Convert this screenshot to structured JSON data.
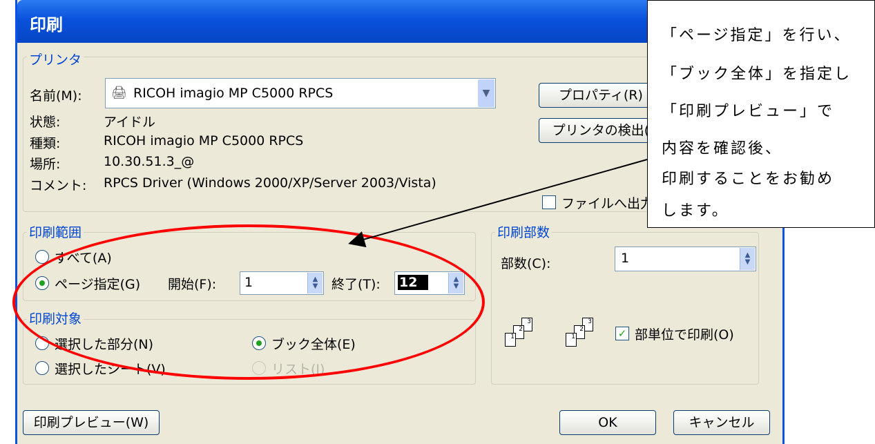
{
  "window": {
    "title": "印刷"
  },
  "printer": {
    "group_label": "プリンタ",
    "name_label": "名前(M):",
    "name_value": "RICOH imagio MP C5000 RPCS",
    "status_label": "状態:",
    "status_value": "アイドル",
    "type_label": "種類:",
    "type_value": "RICOH imagio MP C5000 RPCS",
    "location_label": "場所:",
    "location_value": "10.30.51.3_@",
    "comment_label": "コメント:",
    "comment_value": "RPCS Driver (Windows 2000/XP/Server 2003/Vista)",
    "properties_button": "プロパティ(R)",
    "find_button": "プリンタの検出(",
    "print_to_file_label": "ファイルへ出力"
  },
  "range": {
    "group_label": "印刷範囲",
    "all_label": "すべて(A)",
    "pages_label": "ページ指定(G)",
    "from_label": "開始(F):",
    "from_value": "1",
    "to_label": "終了(T):",
    "to_value": "12"
  },
  "target": {
    "group_label": "印刷対象",
    "selection_label": "選択した部分(N)",
    "sheet_label": "選択したシート(V)",
    "workbook_label": "ブック全体(E)",
    "list_label": "リスト(I)"
  },
  "copies": {
    "group_label": "印刷部数",
    "count_label": "部数(C):",
    "count_value": "1",
    "collate_label": "部単位で印刷(O)"
  },
  "footer": {
    "preview_button": "印刷プレビュー(W)",
    "ok_button": "OK",
    "cancel_button": "キャンセル"
  },
  "callout": {
    "lines": [
      "「ページ指定」を行い、",
      "「ブック全体」を指定し",
      "「印刷プレビュー」で",
      "内容を確認後、",
      "印刷することをお勧め",
      "します。"
    ]
  },
  "annotation_color": "#ff0000"
}
